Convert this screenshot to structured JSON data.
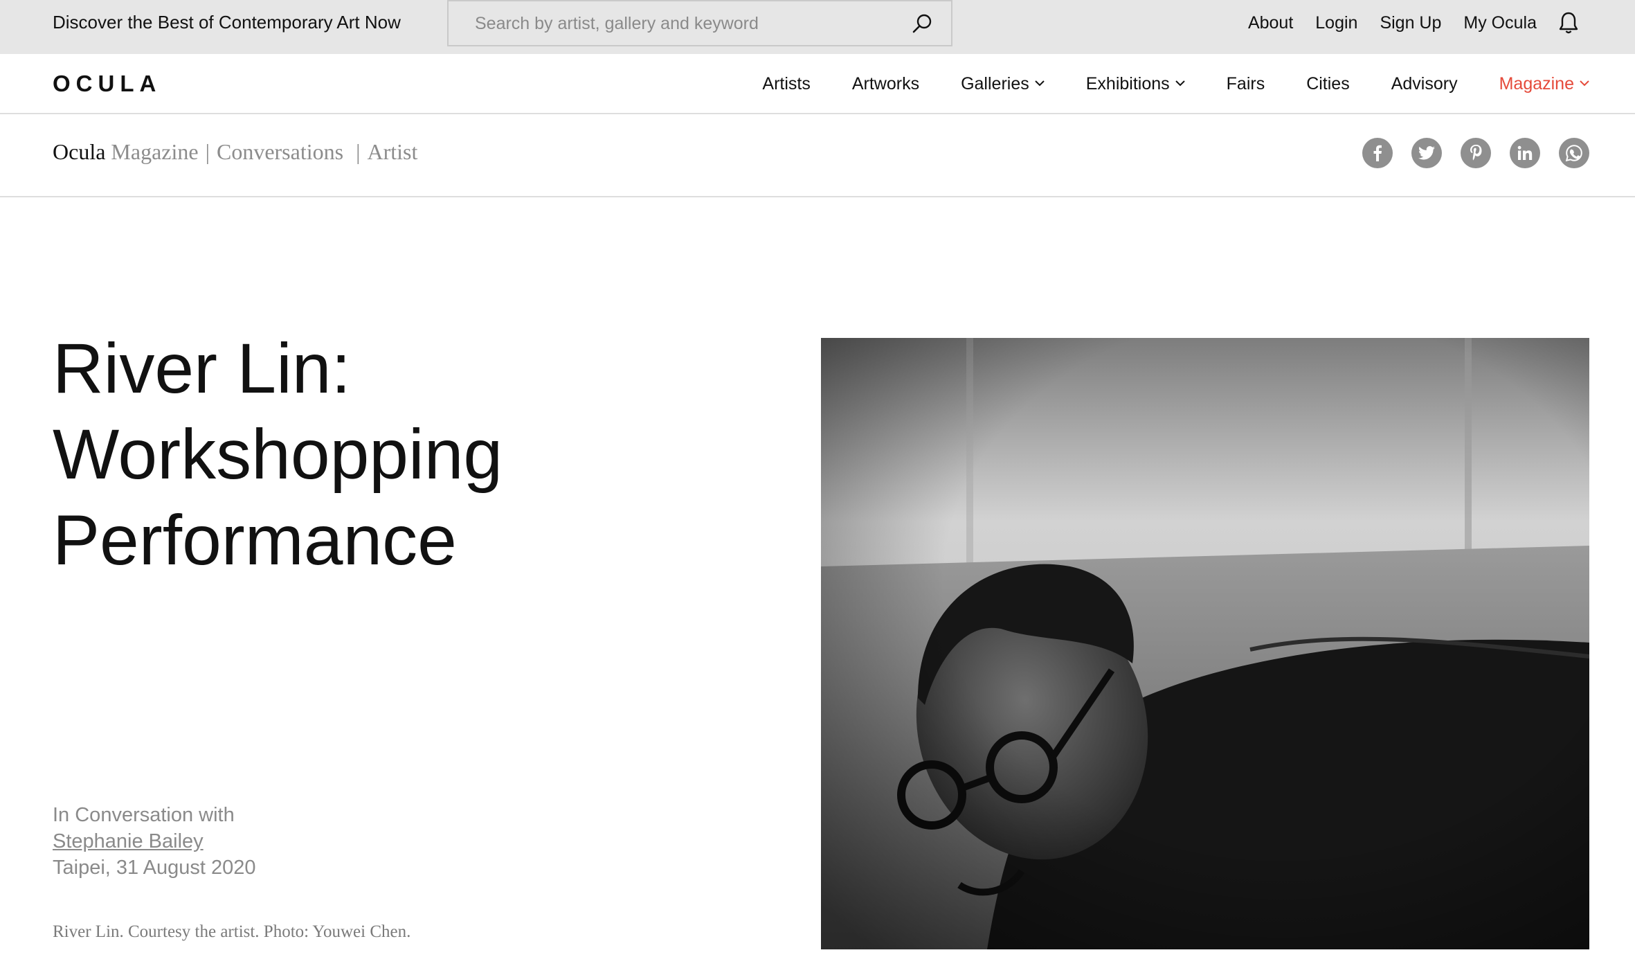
{
  "topbar": {
    "tagline": "Discover the Best of Contemporary Art Now",
    "search_placeholder": "Search by artist, gallery and keyword",
    "links": [
      "About",
      "Login",
      "Sign Up",
      "My Ocula"
    ]
  },
  "nav": {
    "logo": "OCULA",
    "items": [
      {
        "label": "Artists"
      },
      {
        "label": "Artworks"
      },
      {
        "label": "Galleries"
      },
      {
        "label": "Exhibitions"
      },
      {
        "label": "Fairs"
      },
      {
        "label": "Cities"
      },
      {
        "label": "Advisory"
      },
      {
        "label": "Magazine"
      }
    ]
  },
  "breadcrumb": {
    "brand": "Ocula",
    "section": "Magazine",
    "category": "Conversations",
    "subcategory": "Artist"
  },
  "share_icons": [
    "facebook-icon",
    "twitter-icon",
    "pinterest-icon",
    "linkedin-icon",
    "whatsapp-icon"
  ],
  "article": {
    "title_line1": "River Lin:",
    "title_line2": "Workshopping",
    "title_line3": "Performance",
    "intro": "In Conversation with",
    "author": "Stephanie Bailey",
    "place_date": "Taipei, 31 August 2020",
    "caption": "River Lin. Courtesy the artist. Photo: Youwei Chen."
  },
  "colors": {
    "topbar_bg": "#e6e6e6",
    "accent": "#e54a3a",
    "muted_text": "#8a8a8a",
    "share_icon_bg": "#8f8f8f"
  }
}
